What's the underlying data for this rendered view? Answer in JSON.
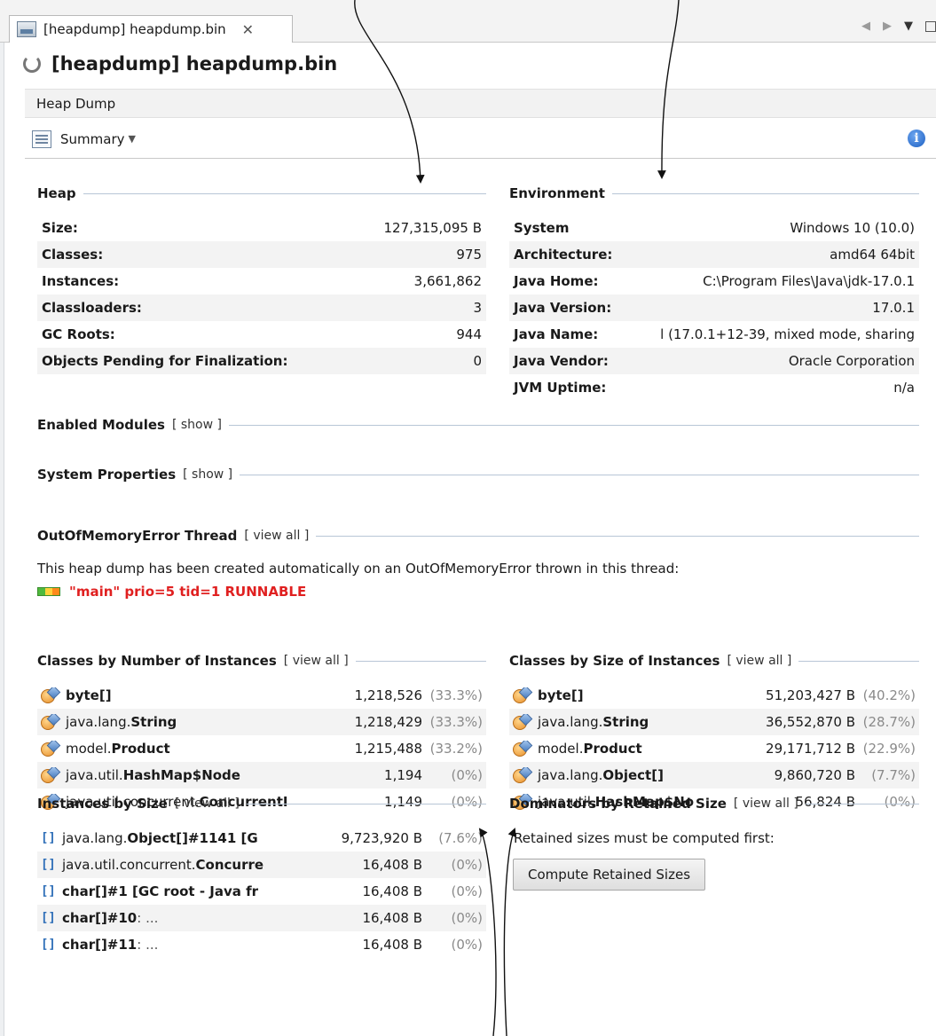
{
  "tab": {
    "label": "[heapdump] heapdump.bin",
    "close": "✕"
  },
  "window_controls": {
    "prev": "◀",
    "next": "▶",
    "menu": "▼"
  },
  "header": {
    "title": "[heapdump] heapdump.bin",
    "section": "Heap Dump",
    "view": "Summary",
    "info": "i"
  },
  "heap": {
    "title": "Heap",
    "rows": [
      {
        "label": "Size:",
        "value": "127,315,095 B"
      },
      {
        "label": "Classes:",
        "value": "975"
      },
      {
        "label": "Instances:",
        "value": "3,661,862"
      },
      {
        "label": "Classloaders:",
        "value": "3"
      },
      {
        "label": "GC Roots:",
        "value": "944"
      },
      {
        "label": "Objects Pending for Finalization:",
        "value": "0"
      }
    ]
  },
  "environment": {
    "title": "Environment",
    "rows": [
      {
        "label": "System",
        "value": "Windows 10 (10.0)"
      },
      {
        "label": "Architecture:",
        "value": "amd64 64bit"
      },
      {
        "label": "Java Home:",
        "value": "C:\\Program Files\\Java\\jdk-17.0.1"
      },
      {
        "label": "Java Version:",
        "value": "17.0.1"
      },
      {
        "label": "Java Name:",
        "value": "l (17.0.1+12-39, mixed mode, sharing"
      },
      {
        "label": "Java Vendor:",
        "value": "Oracle Corporation"
      },
      {
        "label": "JVM Uptime:",
        "value": "n/a"
      }
    ]
  },
  "modules": {
    "title": "Enabled Modules",
    "link": "[ show ]"
  },
  "sysprops": {
    "title": "System Properties",
    "link": "[ show ]"
  },
  "oom": {
    "title": "OutOfMemoryError Thread",
    "link": "[ view all ]",
    "note": "This heap dump has been created automatically on an OutOfMemoryError thrown in this thread:",
    "thread": "\"main\" prio=5 tid=1 RUNNABLE"
  },
  "classes_by_count": {
    "title": "Classes by Number of Instances",
    "link": "[ view all ]",
    "rows": [
      {
        "pre": "",
        "name": "byte[]",
        "count": "1,218,526",
        "pct": "(33.3%)"
      },
      {
        "pre": "java.lang.",
        "name": "String",
        "count": "1,218,429",
        "pct": "(33.3%)"
      },
      {
        "pre": "model.",
        "name": "Product",
        "count": "1,215,488",
        "pct": "(33.2%)"
      },
      {
        "pre": "java.util.",
        "name": "HashMap$Node",
        "count": "1,194",
        "pct": "(0%)"
      },
      {
        "pre": "java.util.concurrent.",
        "name": "ConcurrentI",
        "count": "1,149",
        "pct": "(0%)"
      }
    ]
  },
  "classes_by_size": {
    "title": "Classes by Size of Instances",
    "link": "[ view all ]",
    "rows": [
      {
        "pre": "",
        "name": "byte[]",
        "size": "51,203,427 B",
        "pct": "(40.2%)"
      },
      {
        "pre": "java.lang.",
        "name": "String",
        "size": "36,552,870 B",
        "pct": "(28.7%)"
      },
      {
        "pre": "model.",
        "name": "Product",
        "size": "29,171,712 B",
        "pct": "(22.9%)"
      },
      {
        "pre": "java.lang.",
        "name": "Object[]",
        "size": "9,860,720 B",
        "pct": "(7.7%)"
      },
      {
        "pre": "java.util.",
        "name": "HashMap$No",
        "size": "56,824 B",
        "pct": "(0%)"
      }
    ]
  },
  "instances_by_size": {
    "title": "Instances by Size",
    "link": "[ view all ]",
    "rows": [
      {
        "pre": "java.lang.",
        "name": "Object[]#1141 [G",
        "sfx": "",
        "size": "9,723,920 B",
        "pct": "(7.6%)"
      },
      {
        "pre": "java.util.concurrent.",
        "name": "Concurre",
        "sfx": "",
        "size": "16,408 B",
        "pct": "(0%)"
      },
      {
        "pre": "",
        "name": "char[]#1 [GC root - Java fr",
        "sfx": "",
        "size": "16,408 B",
        "pct": "(0%)"
      },
      {
        "pre": "",
        "name": "char[]#10",
        "sfx": "  : ...",
        "size": "16,408 B",
        "pct": "(0%)"
      },
      {
        "pre": "",
        "name": "char[]#11",
        "sfx": "  : ...",
        "size": "16,408 B",
        "pct": "(0%)"
      }
    ]
  },
  "dominators": {
    "title": "Dominators by Retained Size",
    "link": "[ view all ]",
    "note": "Retained sizes must be computed first:",
    "button": "Compute Retained Sizes"
  },
  "colors": {
    "thread_red": "#e02020",
    "rule_blue": "#b8c6d6",
    "info_blue": "#1c5fc2"
  }
}
